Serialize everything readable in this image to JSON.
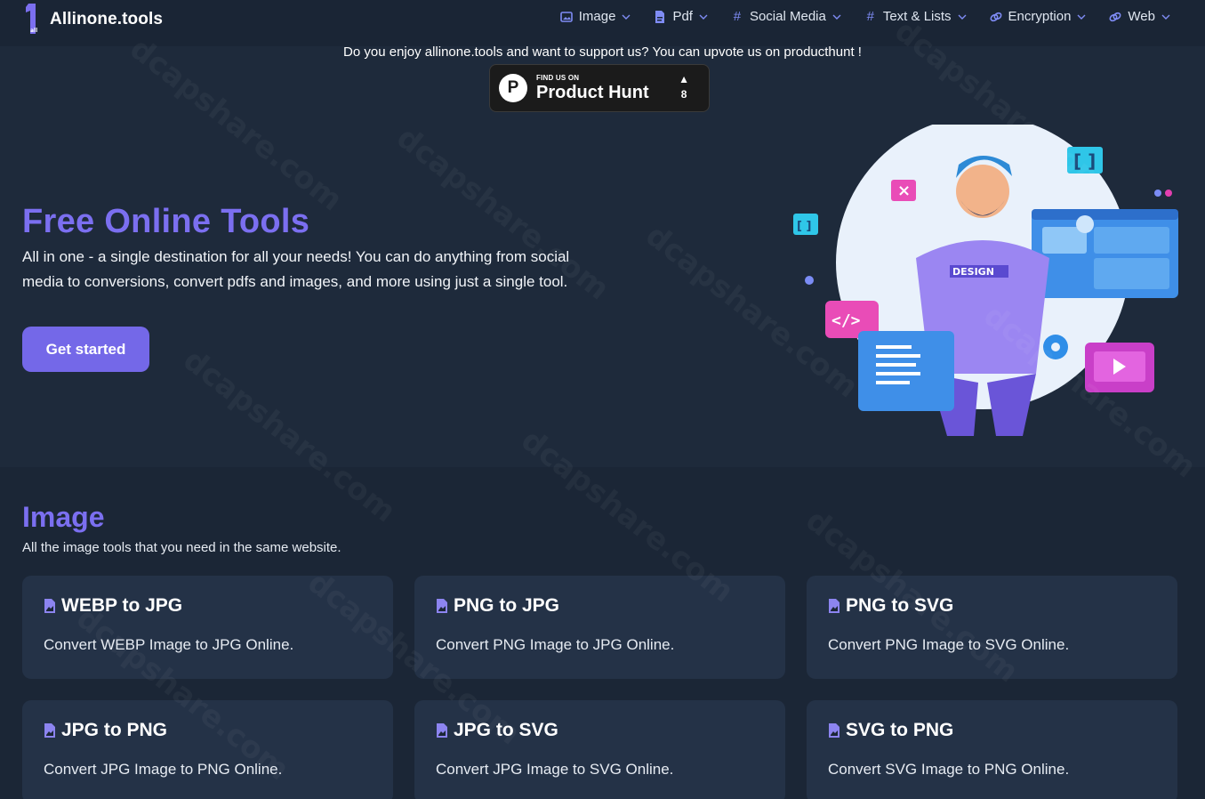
{
  "brand": {
    "name": "Allinone.tools"
  },
  "nav": {
    "items": [
      {
        "label": "Image",
        "icon": "image-icon"
      },
      {
        "label": "Pdf",
        "icon": "pdf-file-icon"
      },
      {
        "label": "Social Media",
        "icon": "hash-icon"
      },
      {
        "label": "Text & Lists",
        "icon": "hash-icon"
      },
      {
        "label": "Encryption",
        "icon": "link-icon"
      },
      {
        "label": "Web",
        "icon": "link-icon"
      }
    ]
  },
  "support": {
    "text": "Do you enjoy allinone.tools and want to support us? You can upvote us on producthunt !",
    "badge_small": "FIND US ON",
    "badge_big": "Product Hunt",
    "badge_letter": "P",
    "badge_arrow": "▲",
    "upvotes": "8"
  },
  "hero": {
    "title": "Free Online Tools",
    "description": "All in one - a single destination for all your needs! You can do anything from social media to conversions, convert pdfs and images, and more using just a single tool.",
    "cta": "Get started",
    "illustration_badge": "DESIGN"
  },
  "section": {
    "title": "Image",
    "subtitle": "All the image tools that you need in the same website.",
    "cards": [
      {
        "title": "WEBP to JPG",
        "desc": "Convert WEBP Image to JPG Online."
      },
      {
        "title": "PNG to JPG",
        "desc": "Convert PNG Image to JPG Online."
      },
      {
        "title": "PNG to SVG",
        "desc": "Convert PNG Image to SVG Online."
      },
      {
        "title": "JPG to PNG",
        "desc": "Convert JPG Image to PNG Online."
      },
      {
        "title": "JPG to SVG",
        "desc": "Convert JPG Image to SVG Online."
      },
      {
        "title": "SVG to PNG",
        "desc": "Convert SVG Image to PNG Online."
      }
    ]
  },
  "watermark": "dcapshare.com",
  "colors": {
    "accent": "#7b6ff0",
    "button": "#7468e8",
    "background": "#1e2a3b",
    "card": "#243247"
  }
}
